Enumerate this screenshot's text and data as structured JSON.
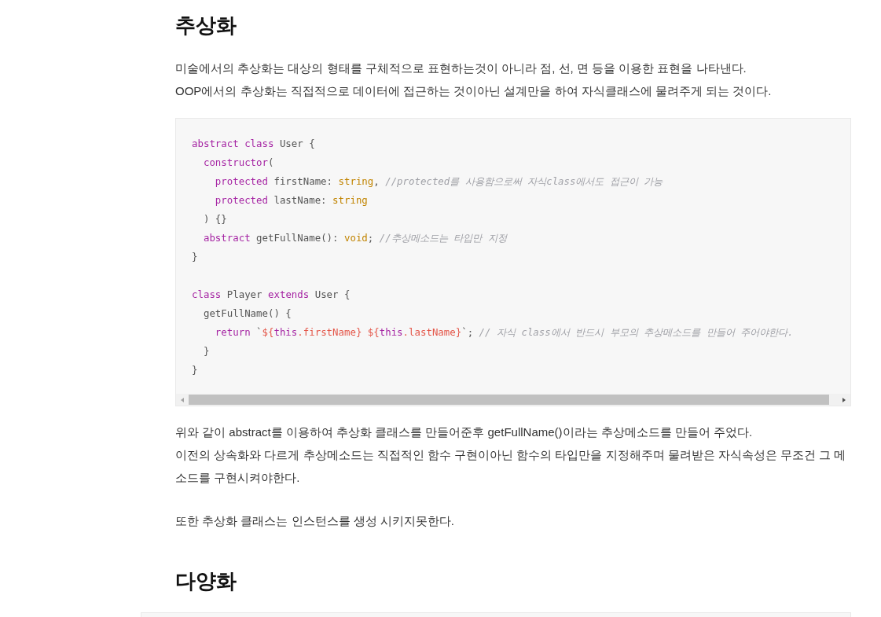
{
  "sections": [
    {
      "heading": "추상화",
      "paragraphs": [
        "미술에서의 추상화는 대상의 형태를 구체적으로 표현하는것이 아니라 점, 선, 면 등을 이용한 표현을 나타낸다.",
        "OOP에서의 추상화는 직접적으로 데이터에 접근하는 것이아닌 설계만을 하여 자식클래스에 물려주게 되는 것이다."
      ],
      "code": {
        "groups": [
          [
            [
              {
                "kind": "keyword",
                "text": "abstract"
              },
              {
                "kind": "keyword",
                "text": " class"
              },
              {
                "kind": "plain",
                "text": " User {"
              }
            ],
            [
              {
                "kind": "keyword",
                "text": "  constructor"
              },
              {
                "kind": "plain",
                "text": "("
              }
            ],
            [
              {
                "kind": "keyword",
                "text": "    protected"
              },
              {
                "kind": "plain",
                "text": " firstName: "
              },
              {
                "kind": "type",
                "text": "string"
              },
              {
                "kind": "plain",
                "text": ", "
              },
              {
                "kind": "comment",
                "text": "//protected를 사용함으로써 자식class에서도 접근이 가능"
              }
            ],
            [
              {
                "kind": "keyword",
                "text": "    protected"
              },
              {
                "kind": "plain",
                "text": " lastName: "
              },
              {
                "kind": "type",
                "text": "string"
              }
            ],
            [
              {
                "kind": "plain",
                "text": "  ) {}"
              }
            ],
            [
              {
                "kind": "keyword",
                "text": "  abstract"
              },
              {
                "kind": "plain",
                "text": " getFullName(): "
              },
              {
                "kind": "type",
                "text": "void"
              },
              {
                "kind": "plain",
                "text": "; "
              },
              {
                "kind": "comment",
                "text": "//추상메소드는 타입만 지정"
              }
            ],
            [
              {
                "kind": "plain",
                "text": "}"
              }
            ]
          ],
          [
            [
              {
                "kind": "keyword",
                "text": "class"
              },
              {
                "kind": "plain",
                "text": " Player "
              },
              {
                "kind": "keyword",
                "text": "extends"
              },
              {
                "kind": "plain",
                "text": " User {"
              }
            ],
            [
              {
                "kind": "plain",
                "text": "  getFullName() {"
              }
            ],
            [
              {
                "kind": "keyword",
                "text": "    return"
              },
              {
                "kind": "plain",
                "text": " `"
              },
              {
                "kind": "string",
                "text": "${"
              },
              {
                "kind": "keyword",
                "text": "this"
              },
              {
                "kind": "string",
                "text": ".firstName} ${"
              },
              {
                "kind": "keyword",
                "text": "this"
              },
              {
                "kind": "string",
                "text": ".lastName}"
              },
              {
                "kind": "plain",
                "text": "`; "
              },
              {
                "kind": "comment",
                "text": "// 자식 class에서 반드시 부모의 추상메소드를 만들어 주어야한다."
              }
            ],
            [
              {
                "kind": "plain",
                "text": "  }"
              }
            ],
            [
              {
                "kind": "plain",
                "text": "}"
              }
            ]
          ]
        ],
        "scrollbar": true
      },
      "paragraphs_after": [
        [
          "위와 같이 abstract를 이용하여 추상화 클래스를 만들어준후 getFullName()이라는 추상메소드를 만들어 주었다.",
          "이전의 상속화와 다르게 추상메소드는 직접적인 함수 구현이아닌 함수의 타입만을 지정해주며 물려받은 자식속성은 무조건 그 메소드를 구현시켜야한다."
        ],
        [
          "또한 추상화 클래스는 인스턴스를 생성 시키지못한다."
        ]
      ]
    },
    {
      "heading": "다양화",
      "cut_code_block": true
    }
  ]
}
